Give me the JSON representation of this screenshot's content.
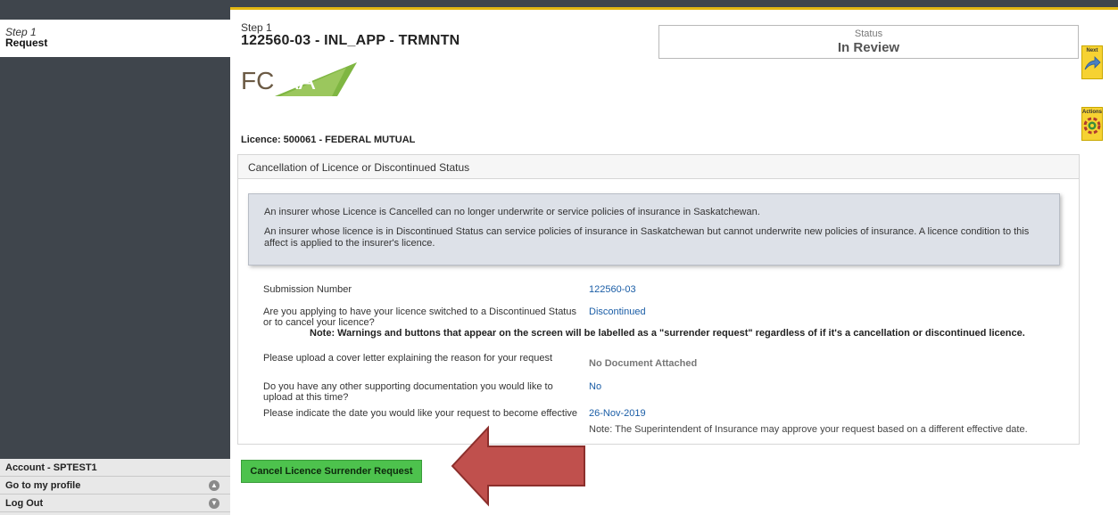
{
  "sidebar": {
    "step_number": "Step 1",
    "step_name": "Request",
    "account_title": "Account - SPTEST1",
    "profile_link": "Go to my profile",
    "logout_link": "Log Out"
  },
  "header": {
    "step_label": "Step 1",
    "title": "122560-03 - INL_APP - TRMNTN",
    "status_label": "Status",
    "status_value": "In Review",
    "logo_text": "FCAA"
  },
  "side_buttons": {
    "next_label": "Next",
    "actions_label": "Actions"
  },
  "licence": "Licence: 500061 - FEDERAL MUTUAL",
  "panel": {
    "heading": "Cancellation of Licence or Discontinued Status",
    "info": [
      "An insurer whose Licence is Cancelled can no longer underwrite or service policies of insurance in Saskatchewan.",
      "An insurer whose licence is in Discontinued Status can service policies of insurance in Saskatchewan but cannot underwrite new policies of insurance. A licence condition to this affect is applied to the insurer's licence."
    ],
    "fields": [
      {
        "question": "Submission Number",
        "answer": "122560-03"
      },
      {
        "question": "Are you applying to have your licence switched to a Discontinued Status or to cancel your licence?",
        "answer": "Discontinued"
      },
      {
        "question": "Please upload a cover letter explaining the reason for your request",
        "answer": "No Document Attached"
      },
      {
        "question": "Do you have any other supporting documentation you would like to upload at this time?",
        "answer": "No"
      },
      {
        "question": "Please indicate the date you would like your request to become effective",
        "answer": "26-Nov-2019"
      }
    ],
    "warning_note": "Note: Warnings and buttons that appear on the screen will be labelled as a \"surrender request\" regardless of if it's a cancellation or discontinued licence.",
    "date_note": "Note: The Superintendent of Insurance may approve your request based on a different effective date."
  },
  "actions": {
    "cancel_button": "Cancel Licence Surrender Request"
  },
  "colors": {
    "sidebar": "#3f454c",
    "accent_yellow": "#e3b712",
    "link_blue": "#1a5da6",
    "button_green": "#4dc24d",
    "arrow_red": "#c0504d"
  }
}
